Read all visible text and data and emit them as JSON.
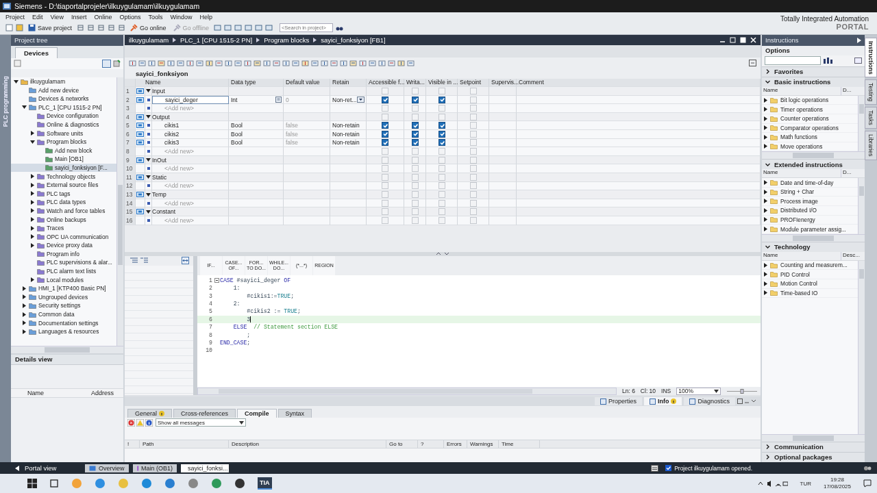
{
  "window": {
    "title": "Siemens  -  D:\\tiaportalprojeler\\ilkuygulamam\\ilkuygulamam"
  },
  "menu": [
    "Project",
    "Edit",
    "View",
    "Insert",
    "Online",
    "Options",
    "Tools",
    "Window",
    "Help"
  ],
  "toolbar": {
    "buttons": [
      {
        "label": "Save project",
        "disabled": false
      },
      {
        "label": "Go online",
        "disabled": false
      },
      {
        "label": "Go offline",
        "disabled": true
      }
    ],
    "search": {
      "placeholder": "<Search in project>"
    }
  },
  "brand": {
    "name": "Totally Integrated Automation",
    "product": "PORTAL"
  },
  "side_tab": "PLC programming",
  "project_tree": {
    "title": "Project tree",
    "tab": "Devices",
    "items": [
      {
        "label": "ilkuygulamam",
        "expanded": true,
        "selected": false,
        "children": [
          {
            "label": "Add new device",
            "selected": false
          },
          {
            "label": "Devices & networks",
            "selected": false
          },
          {
            "label": "PLC_1 [CPU 1515-2 PN]",
            "expanded": true,
            "selected": false,
            "children": [
              {
                "label": "Device configuration",
                "selected": false
              },
              {
                "label": "Online & diagnostics",
                "selected": false
              },
              {
                "label": "Software units",
                "expanded": false,
                "selected": false
              },
              {
                "label": "Program blocks",
                "expanded": true,
                "selected": false,
                "children": [
                  {
                    "label": "Add new block",
                    "selected": false
                  },
                  {
                    "label": "Main [OB1]",
                    "selected": false
                  },
                  {
                    "label": "sayici_fonksiyon [F...",
                    "selected": true
                  }
                ]
              },
              {
                "label": "Technology objects",
                "expanded": false,
                "selected": false
              },
              {
                "label": "External source files",
                "expanded": false,
                "selected": false
              },
              {
                "label": "PLC tags",
                "expanded": false,
                "selected": false
              },
              {
                "label": "PLC data types",
                "expanded": false,
                "selected": false
              },
              {
                "label": "Watch and force tables",
                "expanded": false,
                "selected": false
              },
              {
                "label": "Online backups",
                "expanded": false,
                "selected": false
              },
              {
                "label": "Traces",
                "expanded": false,
                "selected": false
              },
              {
                "label": "OPC UA communication",
                "expanded": false,
                "selected": false
              },
              {
                "label": "Device proxy data",
                "expanded": false,
                "selected": false
              },
              {
                "label": "Program info",
                "selected": false
              },
              {
                "label": "PLC supervisions & alar...",
                "selected": false
              },
              {
                "label": "PLC alarm text lists",
                "selected": false
              },
              {
                "label": "Local modules",
                "expanded": false,
                "selected": false
              }
            ]
          },
          {
            "label": "HMI_1 [KTP400 Basic PN]",
            "expanded": false,
            "selected": false
          },
          {
            "label": "Ungrouped devices",
            "expanded": false,
            "selected": false
          },
          {
            "label": "Security settings",
            "expanded": false,
            "selected": false
          },
          {
            "label": "Common data",
            "expanded": false,
            "selected": false
          },
          {
            "label": "Documentation settings",
            "expanded": false,
            "selected": false
          },
          {
            "label": "Languages & resources",
            "expanded": false,
            "selected": false
          }
        ]
      }
    ]
  },
  "details_view": {
    "title": "Details view",
    "columns": [
      "Name",
      "Address"
    ]
  },
  "editor": {
    "breadcrumb": [
      "ilkuygulamam",
      "PLC_1 [CPU 1515-2 PN]",
      "Program blocks",
      "sayici_fonksiyon [FB1]"
    ],
    "block_name": "sayici_fonksiyon",
    "columns": [
      "Name",
      "Data type",
      "Default value",
      "Retain",
      "Accessible f...",
      "Writa...",
      "Visible in ...",
      "Setpoint",
      "Supervis...",
      "Comment"
    ],
    "rows": [
      {
        "no": "1",
        "kind": "section",
        "name": "Input",
        "expanded": true,
        "selected": false,
        "accessible": false,
        "writable": false,
        "visible": false,
        "setpoint": false
      },
      {
        "no": "2",
        "kind": "var",
        "name": "sayici_deger",
        "data_type": "Int",
        "default": "0",
        "retain": "Non-ret...",
        "selected": true,
        "accessible": true,
        "writable": true,
        "visible": true,
        "setpoint": false
      },
      {
        "no": "3",
        "kind": "add",
        "name": "<Add new>",
        "selected": false,
        "accessible": false,
        "writable": false,
        "visible": false,
        "setpoint": false
      },
      {
        "no": "4",
        "kind": "section",
        "name": "Output",
        "expanded": true,
        "selected": false,
        "accessible": false,
        "writable": false,
        "visible": false,
        "setpoint": false
      },
      {
        "no": "5",
        "kind": "var",
        "name": "cikis1",
        "data_type": "Bool",
        "default": "false",
        "retain": "Non-retain",
        "selected": false,
        "accessible": true,
        "writable": true,
        "visible": true,
        "setpoint": false
      },
      {
        "no": "6",
        "kind": "var",
        "name": "cikis2",
        "data_type": "Bool",
        "default": "false",
        "retain": "Non-retain",
        "selected": false,
        "accessible": true,
        "writable": true,
        "visible": true,
        "setpoint": false
      },
      {
        "no": "7",
        "kind": "var",
        "name": "cikis3",
        "data_type": "Bool",
        "default": "false",
        "retain": "Non-retain",
        "selected": false,
        "accessible": true,
        "writable": true,
        "visible": true,
        "setpoint": false
      },
      {
        "no": "8",
        "kind": "add",
        "name": "<Add new>",
        "selected": false,
        "accessible": false,
        "writable": false,
        "visible": false,
        "setpoint": false
      },
      {
        "no": "9",
        "kind": "section",
        "name": "InOut",
        "expanded": true,
        "selected": false,
        "accessible": false,
        "writable": false,
        "visible": false,
        "setpoint": false
      },
      {
        "no": "10",
        "kind": "add",
        "name": "<Add new>",
        "selected": false,
        "accessible": false,
        "writable": false,
        "visible": false,
        "setpoint": false
      },
      {
        "no": "11",
        "kind": "section",
        "name": "Static",
        "expanded": true,
        "selected": false,
        "accessible": false,
        "writable": false,
        "visible": false,
        "setpoint": false
      },
      {
        "no": "12",
        "kind": "add",
        "name": "<Add new>",
        "selected": false,
        "accessible": false,
        "writable": false,
        "visible": false,
        "setpoint": false
      },
      {
        "no": "13",
        "kind": "section",
        "name": "Temp",
        "expanded": true,
        "selected": false,
        "accessible": false,
        "writable": false,
        "visible": false,
        "setpoint": false
      },
      {
        "no": "14",
        "kind": "add",
        "name": "<Add new>",
        "selected": false,
        "accessible": false,
        "writable": false,
        "visible": false,
        "setpoint": false
      },
      {
        "no": "15",
        "kind": "section",
        "name": "Constant",
        "expanded": true,
        "selected": false,
        "accessible": false,
        "writable": false,
        "visible": false,
        "setpoint": false
      },
      {
        "no": "16",
        "kind": "add",
        "name": "<Add new>",
        "selected": false,
        "accessible": false,
        "writable": false,
        "visible": false,
        "setpoint": false
      }
    ],
    "snippets": [
      "IF...",
      "CASE... OF...",
      "FOR... TO DO...",
      "WHILE... DO...",
      "(*...*)",
      "REGION"
    ],
    "code_lines": [
      {
        "no": "1",
        "fold": true,
        "current": false,
        "tokens": [
          {
            "kind": "keyword",
            "text": "CASE"
          },
          {
            "kind": "plain",
            "text": " #sayici_deger "
          },
          {
            "kind": "keyword",
            "text": "OF"
          }
        ]
      },
      {
        "no": "2",
        "fold": false,
        "current": false,
        "tokens": [
          {
            "kind": "plain",
            "text": "    1:"
          }
        ]
      },
      {
        "no": "3",
        "fold": false,
        "current": false,
        "tokens": [
          {
            "kind": "plain",
            "text": "        #cikis1:="
          },
          {
            "kind": "constant",
            "text": "TRUE"
          },
          {
            "kind": "plain",
            "text": ";"
          }
        ]
      },
      {
        "no": "4",
        "fold": false,
        "current": false,
        "tokens": [
          {
            "kind": "plain",
            "text": "    2:"
          }
        ]
      },
      {
        "no": "5",
        "fold": false,
        "current": false,
        "tokens": [
          {
            "kind": "plain",
            "text": "        #cikis2 := "
          },
          {
            "kind": "constant",
            "text": "TRUE"
          },
          {
            "kind": "plain",
            "text": ";"
          }
        ]
      },
      {
        "no": "6",
        "fold": false,
        "current": true,
        "tokens": [
          {
            "kind": "plain",
            "text": "        3"
          }
        ]
      },
      {
        "no": "7",
        "fold": false,
        "current": false,
        "tokens": [
          {
            "kind": "keyword",
            "text": "    ELSE"
          },
          {
            "kind": "comment",
            "text": "  // Statement section ELSE"
          }
        ]
      },
      {
        "no": "8",
        "fold": false,
        "current": false,
        "tokens": [
          {
            "kind": "plain",
            "text": "        ;"
          }
        ]
      },
      {
        "no": "9",
        "fold": false,
        "current": false,
        "tokens": [
          {
            "kind": "keyword",
            "text": "END_CASE"
          },
          {
            "kind": "plain",
            "text": ";"
          }
        ]
      },
      {
        "no": "10",
        "fold": false,
        "current": false
      }
    ],
    "status": {
      "line": "Ln: 6",
      "column": "Cl: 10",
      "mode": "INS",
      "zoom": "100%",
      "zoom_slider": {
        "level": 0.5
      }
    }
  },
  "inspector": {
    "tabs": [
      {
        "label": "Properties",
        "selected": false,
        "badge": false
      },
      {
        "label": "Info",
        "selected": true,
        "badge": true
      },
      {
        "label": "Diagnostics",
        "selected": false,
        "badge": false
      }
    ],
    "subtabs": [
      {
        "label": "General",
        "selected": false,
        "badge": true
      },
      {
        "label": "Cross-references",
        "selected": false,
        "badge": false
      },
      {
        "label": "Compile",
        "selected": true,
        "badge": false
      },
      {
        "label": "Syntax",
        "selected": false,
        "badge": false
      }
    ],
    "filter": "Show all messages",
    "columns": [
      "!",
      "Path",
      "Description",
      "Go to",
      "?",
      "Errors",
      "Warnings",
      "Time"
    ]
  },
  "instructions": {
    "title": "Instructions",
    "options_label": "Options",
    "sections": [
      {
        "title": "Favorites",
        "expanded": false
      },
      {
        "title": "Basic instructions",
        "expanded": true,
        "columns": [
          "Name",
          "D..."
        ],
        "items": [
          "Bit logic operations",
          "Timer operations",
          "Counter operations",
          "Comparator operations",
          "Math functions",
          "Move operations"
        ]
      },
      {
        "title": "Extended instructions",
        "expanded": true,
        "columns": [
          "Name",
          "D..."
        ],
        "items": [
          "Date and time-of-day",
          "String + Char",
          "Process image",
          "Distributed I/O",
          "PROFIenergy",
          "Module parameter assig..."
        ]
      },
      {
        "title": "Technology",
        "expanded": true,
        "columns": [
          "Name",
          "Desc..."
        ],
        "items": [
          "Counting and measurem...",
          "PID Control",
          "Motion Control",
          "Time-based IO"
        ]
      },
      {
        "title": "Communication",
        "expanded": false
      },
      {
        "title": "Optional packages",
        "expanded": false
      }
    ]
  },
  "side_tabs": [
    {
      "label": "Instructions",
      "selected": true
    },
    {
      "label": "Testing",
      "selected": false
    },
    {
      "label": "Tasks",
      "selected": false
    },
    {
      "label": "Libraries",
      "selected": false
    }
  ],
  "portal_bar": {
    "portal_view": "Portal view",
    "editors": [
      {
        "label": "Overview",
        "selected": false
      },
      {
        "label": "Main (OB1)",
        "selected": false
      },
      {
        "label": "sayici_fonksi...",
        "selected": true
      }
    ],
    "status": "Project ilkuygulamam opened."
  },
  "taskbar": {
    "app_label": "TIA",
    "language": "TUR",
    "time": "19:28",
    "date": "17/08/2025"
  }
}
